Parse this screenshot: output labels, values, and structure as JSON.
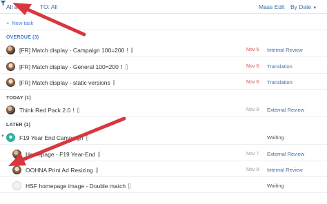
{
  "toolbar": {
    "all_active": "All active",
    "to_all": "TO: All",
    "mass_edit": "Mass Edit",
    "by_date": "By Date"
  },
  "new_task": "New task",
  "sections": {
    "overdue": "OVERDUE (3)",
    "today": "TODAY (1)",
    "later": "LATER (1)"
  },
  "tasks": [
    {
      "title": "[FR] Match display - Campaign 100=200",
      "urgent": true,
      "date": "Nov 5",
      "status": "Internal Review"
    },
    {
      "title": "[FR] Match display - General 100=200",
      "urgent": true,
      "date": "Nov 6",
      "status": "Translation"
    },
    {
      "title": "[FR] Match display - static versions",
      "urgent": false,
      "date": "Nov 6",
      "status": "Translation"
    },
    {
      "title": "Think Red Pack 2.0",
      "urgent": true,
      "date": "Nov 8",
      "status": "External Review"
    },
    {
      "title": "F19 Year End Campaign",
      "urgent": false,
      "date": "",
      "status": "Waiting"
    },
    {
      "title": "Homepage - F19 Year-End",
      "urgent": false,
      "date": "Nov 7",
      "status": "External Review"
    },
    {
      "title": "OOHNA Print Ad Resizing",
      "urgent": false,
      "date": "Nov 8",
      "status": "Internal Review"
    },
    {
      "title": "HSF homepage image - Double match",
      "urgent": false,
      "date": "",
      "status": "Waiting"
    }
  ],
  "colors": {
    "annotation_arrow": "#d9363e",
    "link_blue": "#3a6ea5",
    "overdue_date": "#e0474c"
  }
}
